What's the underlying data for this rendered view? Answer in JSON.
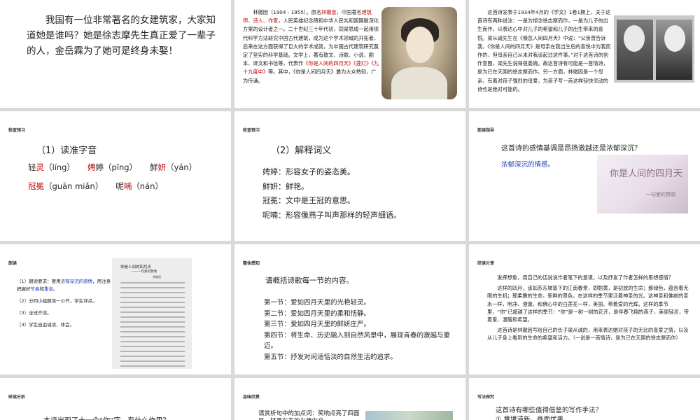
{
  "slide1": {
    "text": "我国有一位非常著名的女建筑家，大家知道她是谁吗？她是徐志摩先生真正爱了一辈子的人，金岳霖为了她可是终身未娶！"
  },
  "slide2": {
    "bio_p1": "林徽因（1904 - 1955）。原名",
    "bio_name": "林徽音",
    "bio_p2": "，中国著名",
    "bio_roles": "建筑师、诗人、作家",
    "bio_p3": "，人民英雄纪念碑和中华人民共和国国徽深化方案的设计者之一。二十世纪三十年代初，同梁思成一起用现代科学方法研究中国古代建筑，成为这个学术领域的开拓者，后来在这方面获得了巨大的学术成就，为中国古代建筑研究奠定了坚实的科学基础。文学上，著有散文、诗歌、小说、剧本、译文和书信等，代表作",
    "bio_works": "《你是人间的四月天》《莲灯》《九十九度中》",
    "bio_p4": "等。其中，《你是人间四月天》最为大众熟知，广为传诵。"
  },
  "slide3": {
    "text": "这首诗发表于1934年4月的《学文》1卷1期上，关于这首诗有两种说法：一是为悼念徐志摩而作，一是为儿子的出生而作，以表达心中对儿子的希望和儿子的出生带来的喜悦。梁从诫先生在《倏忽人间四月天》中说：“父亲曾告诉我，《你是人间的四月天》是母亲在我出生后的喜悦中为我而作的，但母亲自己从未对我谈起过这件事。”对于这首诗的创作意图，梁先生说得很委婉。故这首诗有可能是一首情诗，是为已在天国的徐志摩而作。另一方面，林徽因是一个母亲，有着对孩子强烈的母爱，为孩子写一首这样轻快灵动的诗也是绝对可能的。"
  },
  "slide4": {
    "label": "检查预习",
    "title": "（1）读准字音",
    "items": {
      "w1a": "轻",
      "w1b": "灵",
      "w1c": "（líng）",
      "w2a": "娉",
      "w2b": "婷（pīng）",
      "w3a": "鲜",
      "w3b": "妍",
      "w3c": "（yán）",
      "w4a": "冠冕",
      "w4b": "（guān miǎn）",
      "w5a": "呢",
      "w5b": "喃",
      "w5c": "（nán）"
    }
  },
  "slide5": {
    "label": "检查预习",
    "title": "（2）解释词义",
    "items": [
      "娉婷：形容女子的姿态美。",
      "鲜妍：鲜艳。",
      "冠冕：文中是王冠的意思。",
      "呢喃：形容像燕子叫声那样的轻声细语。"
    ]
  },
  "slide6": {
    "label": "朗读指导",
    "question": "这首诗的感情基调是昂扬激越还是浓郁深沉？",
    "answer": "浓郁深沉的情感。",
    "img_title": "你是人间的四月天",
    "img_sub": "一句爱的赞颂"
  },
  "slide7": {
    "label": "朗读",
    "item1a": "（1）朗读要求：要用",
    "item1b": "浓郁深沉的感情",
    "item1c": "，用注意把握好",
    "item1d": "节奏",
    "item1e": "和",
    "item1f": "重音",
    "item1g": "。",
    "item2": "（2）分四小组朗读一小节，学生评点。",
    "item3": "（3）全班齐读。",
    "item4": "（4）学生自由诵读、体会。",
    "poem_title": "你是人间的四月天",
    "poem_sub": "——一句爱的赞颂",
    "poem_author": "林徽因"
  },
  "slide8": {
    "label": "整体感知",
    "title": "请概括诗歌每一节的内容。",
    "items": [
      "第一节：爱如四月天里的光艳轻灵。",
      "第二节：爱如四月天里的柔和恬静。",
      "第三节：爱如四月天里的鲜妍庄严。",
      "第四节：将生命、历史融入到自然风景中，展现青春的激越与豪迈。",
      "第五节：抒发对闲适恬淡的自然生活的追求。"
    ]
  },
  "slide9": {
    "label": "研读分享",
    "p1": "发挥想象，用自己的话说说作者笔下的意境，以及抒发了作者怎样的思想感情？",
    "p2": "这样的四月，该如苏东坡笔下的江南春景，即鹅黄，是初放的生命；那绿色，蕴含着无限的生机；那柔嫩的生命，新鲜的景色，在这样的季节里泛着神圣的光。这神圣和佛前的圣水一样，明净、澄澈，和佛心中的白莲花一样，美丽、带着爱的光辉。这样的季节里，“你”已超越了这样的季节：“你”是一树一树的花开，是伴春飞翔的燕子，美丽轻灵，带着爱、温暖和希望。",
    "p3": "这首诗是林徽因写给自己的长子梁从诫的，用来表达她对孩子的无比的喜爱之情，以及从儿子身上看到的生命的希望和活力。（一说是一首情诗，是为已在天国的徐志摩而作）"
  },
  "slide10": {
    "label": "研读分析",
    "text": "本诗出现了十一个“你”字，有什么作用？"
  },
  "slide11": {
    "label": "品味欣赏",
    "text": "请赏析句中的加点词：笑响点亮了四面风，轻灵在春的光艳中交"
  },
  "slide12": {
    "label": "写法探究",
    "question": "这首诗有哪些值得借鉴的写作手法？",
    "answer": "① 意境清新，画面优美"
  }
}
